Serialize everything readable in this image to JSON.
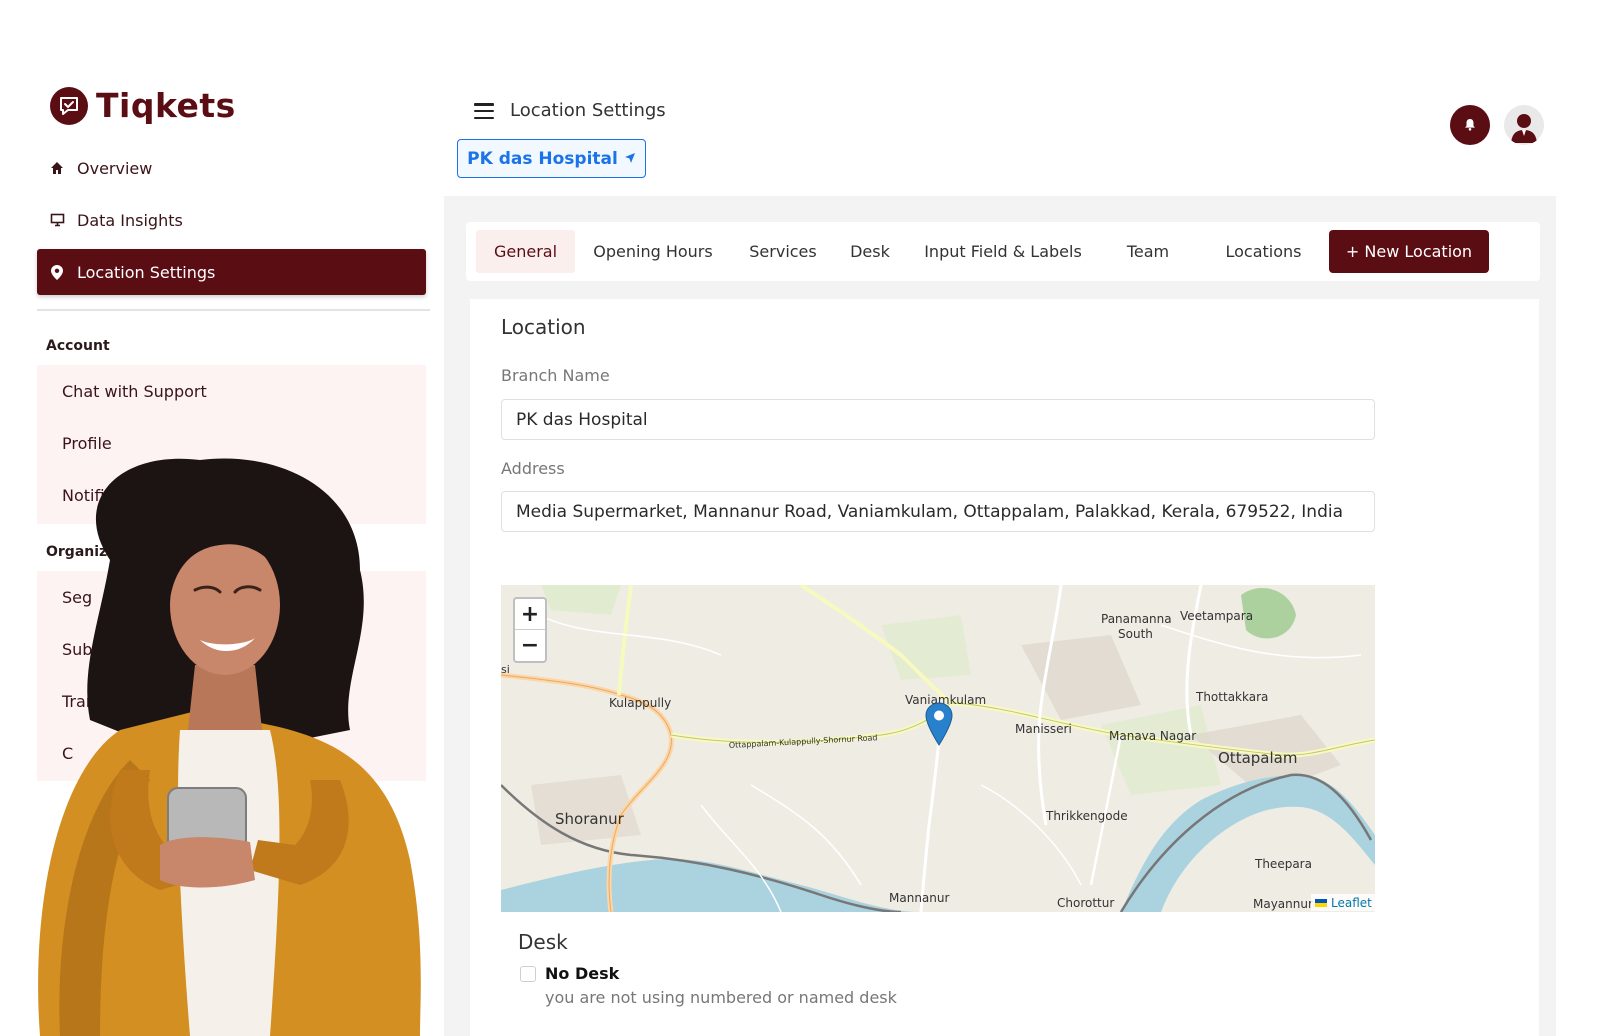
{
  "app": {
    "name": "Tiqkets",
    "brand_color": "#5b0d14",
    "link_color": "#1a73e8"
  },
  "sidebar": {
    "nav": [
      {
        "label": "Overview",
        "icon": "home-icon"
      },
      {
        "label": "Data Insights",
        "icon": "monitor-icon"
      },
      {
        "label": "Location Settings",
        "icon": "map-pin-icon",
        "active": true
      }
    ],
    "account": {
      "title": "Account",
      "items": [
        "Chat with Support",
        "Profile",
        "Notificatio"
      ]
    },
    "organization": {
      "title": "Organiz",
      "items": [
        "Seg",
        "Sub",
        "Transc",
        "C"
      ]
    }
  },
  "header": {
    "title": "Location Settings",
    "location_button": "PK das Hospital",
    "location_icon": "navigation-arrow-icon"
  },
  "tabs": {
    "items": [
      "General",
      "Opening Hours",
      "Services",
      "Desk",
      "Input Field & Labels",
      "Team",
      "Locations"
    ],
    "active": "General",
    "new_location": "+ New Location"
  },
  "form": {
    "section_title": "Location",
    "branch_label": "Branch Name",
    "branch_value": "PK das Hospital",
    "address_label": "Address",
    "address_value": "Media Supermarket, Mannanur Road, Vaniamkulam, Ottappalam, Palakkad, Kerala, 679522, India"
  },
  "map": {
    "zoom_in": "+",
    "zoom_out": "−",
    "attribution": "Leaflet",
    "places": [
      "Panamanna South",
      "Veetampara",
      "Kulappully",
      "Vaniamkulam",
      "Thottakkara",
      "Manisseri",
      "Manava Nagar",
      "Ottapalam",
      "Shoranur",
      "Thrikkengode",
      "Theepara",
      "Mannanur",
      "Chorottur",
      "Mayannur",
      "Ottapalam-Kulapully-Shornur Road",
      "si"
    ]
  },
  "desk": {
    "title": "Desk",
    "option_label": "No Desk",
    "option_desc": "you are not using numbered or named desk",
    "checked": false
  }
}
